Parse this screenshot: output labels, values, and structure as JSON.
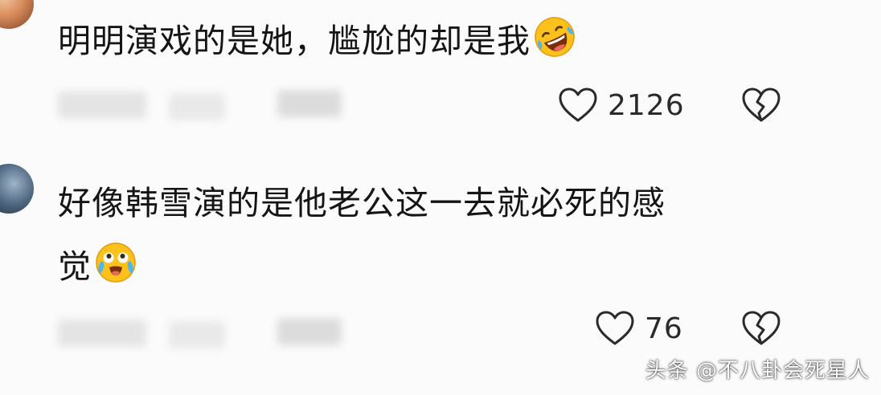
{
  "comments": [
    {
      "text": "明明演戏的是她，尴尬的却是我",
      "emoji": "rolling-on-floor-laughing-emoji",
      "likes": "2126"
    },
    {
      "text_line1": "好像韩雪演的是他老公这一去就必死的感",
      "text_line2": "觉",
      "emoji": "laughing-with-tears-emoji",
      "likes": "76"
    }
  ],
  "watermark": "头条 @不八卦会死星人",
  "colors": {
    "background": "#fbfbfb",
    "text": "#151515",
    "icon_stroke": "#2a2a2a"
  }
}
